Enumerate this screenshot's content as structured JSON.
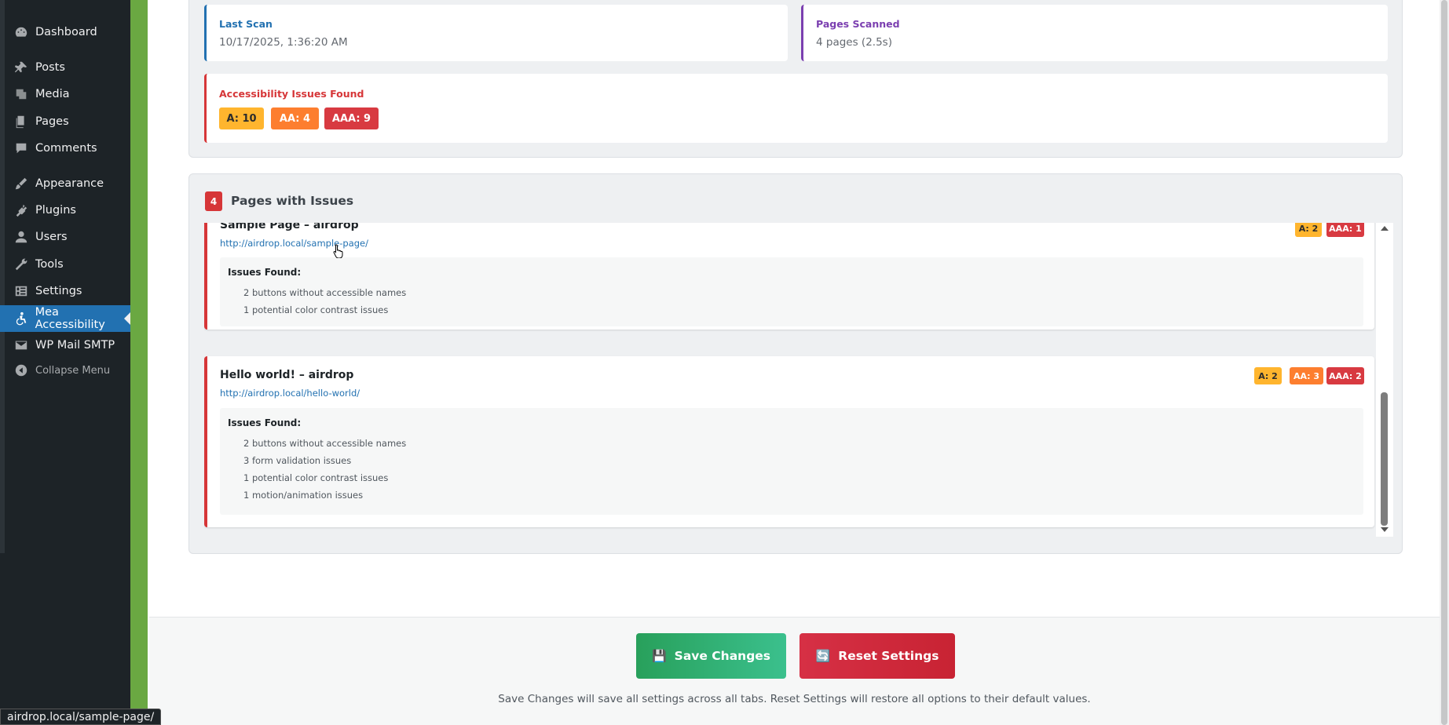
{
  "sidebar": {
    "items": [
      {
        "label": "Dashboard",
        "icon": "dashboard-icon"
      },
      {
        "label": "Posts",
        "icon": "pin-icon"
      },
      {
        "label": "Media",
        "icon": "media-icon"
      },
      {
        "label": "Pages",
        "icon": "pages-icon"
      },
      {
        "label": "Comments",
        "icon": "comment-icon"
      },
      {
        "label": "Appearance",
        "icon": "brush-icon"
      },
      {
        "label": "Plugins",
        "icon": "plugin-icon"
      },
      {
        "label": "Users",
        "icon": "user-icon"
      },
      {
        "label": "Tools",
        "icon": "wrench-icon"
      },
      {
        "label": "Settings",
        "icon": "settings-icon"
      },
      {
        "label": "Mea Accessibility",
        "icon": "accessibility-icon",
        "active": true
      },
      {
        "label": "WP Mail SMTP",
        "icon": "mail-icon"
      }
    ],
    "collapse_label": "Collapse Menu"
  },
  "summary": {
    "last_scan": {
      "label": "Last Scan",
      "value": "10/17/2025, 1:36:20 AM",
      "color": "#2271b1"
    },
    "pages_scanned": {
      "label": "Pages Scanned",
      "value": "4 pages (2.5s)",
      "color": "#7b3fb0"
    },
    "issues": {
      "label": "Accessibility Issues Found",
      "color": "#d63638",
      "badges": {
        "a": "A: 10",
        "aa": "AA: 4",
        "aaa": "AAA: 9"
      }
    }
  },
  "pages_section": {
    "count": "4",
    "title": "Pages with Issues",
    "pages": [
      {
        "title": "Sample Page – airdrop",
        "url": "http://airdrop.local/sample-page/",
        "badges": {
          "a": "A: 2",
          "aaa": "AAA: 1"
        },
        "issues_label": "Issues Found:",
        "issues": [
          "2 buttons without accessible names",
          "1 potential color contrast issues"
        ]
      },
      {
        "title": "Hello world! – airdrop",
        "url": "http://airdrop.local/hello-world/",
        "badges": {
          "a": "A: 2",
          "aa": "AA: 3",
          "aaa": "AAA: 2"
        },
        "issues_label": "Issues Found:",
        "issues": [
          "2 buttons without accessible names",
          "3 form validation issues",
          "1 potential color contrast issues",
          "1 motion/animation issues"
        ]
      }
    ]
  },
  "footer": {
    "save_icon": "💾",
    "save_label": "Save Changes",
    "reset_icon": "🔄",
    "reset_label": "Reset Settings",
    "note": "Save Changes will save all settings across all tabs. Reset Settings will restore all options to their default values."
  },
  "status_bar": {
    "url": "airdrop.local/sample-page/"
  }
}
